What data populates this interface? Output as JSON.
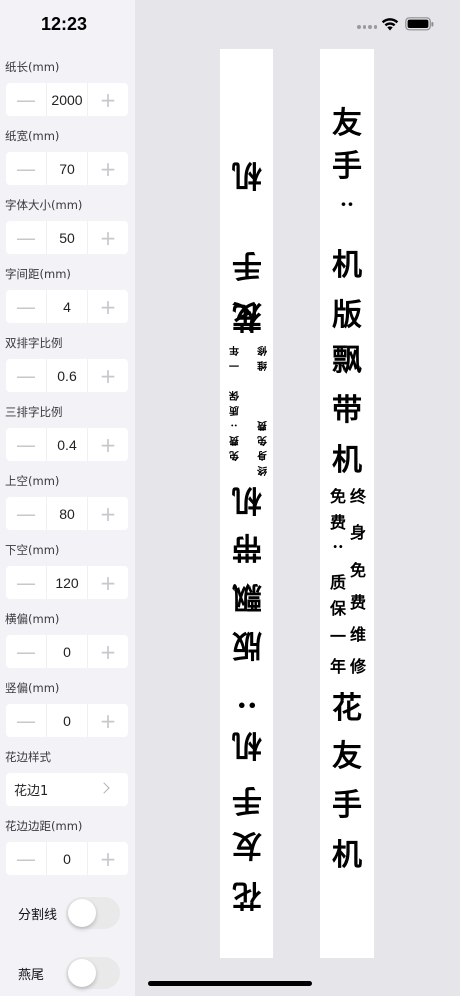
{
  "status": {
    "time": "12:23"
  },
  "params": [
    {
      "label": "纸长(mm)",
      "value": "2000"
    },
    {
      "label": "纸宽(mm)",
      "value": "70"
    },
    {
      "label": "字体大小(mm)",
      "value": "50"
    },
    {
      "label": "字间距(mm)",
      "value": "4"
    },
    {
      "label": "双排字比例",
      "value": "0.6"
    },
    {
      "label": "三排字比例",
      "value": "0.4"
    },
    {
      "label": "上空(mm)",
      "value": "80"
    },
    {
      "label": "下空(mm)",
      "value": "120"
    },
    {
      "label": "横偏(mm)",
      "value": "0"
    },
    {
      "label": "竖偏(mm)",
      "value": "0"
    }
  ],
  "border_style": {
    "label": "花边样式",
    "value": "花边1"
  },
  "border_margin": {
    "label": "花边边距(mm)",
    "value": "0"
  },
  "toggles": {
    "divider": "分割线",
    "swallowtail": "燕尾"
  },
  "stepper_icons": {
    "minus": "—",
    "plus": "+"
  },
  "preview_right": {
    "top_chars": [
      "友",
      "手",
      "··",
      "机",
      "版",
      "飘",
      "带",
      "机"
    ],
    "col1": [
      "免",
      "费",
      "··",
      "质",
      "保",
      "一",
      "年"
    ],
    "col2": [
      "终",
      "身",
      "免",
      "费",
      "维",
      "修"
    ],
    "bottom_chars": [
      "花",
      "友",
      "手",
      "机"
    ]
  },
  "preview_left": {
    "top_chars": [
      "机",
      "手",
      "友",
      "花"
    ],
    "col1": [
      "修",
      "维",
      "费",
      "免",
      "身",
      "终"
    ],
    "col2": [
      "年",
      "一",
      "保",
      "质",
      "··",
      "费",
      "免"
    ],
    "bottom_chars": [
      "机",
      "带",
      "飘",
      "版",
      "机",
      "··",
      "手",
      "友",
      "花"
    ]
  }
}
